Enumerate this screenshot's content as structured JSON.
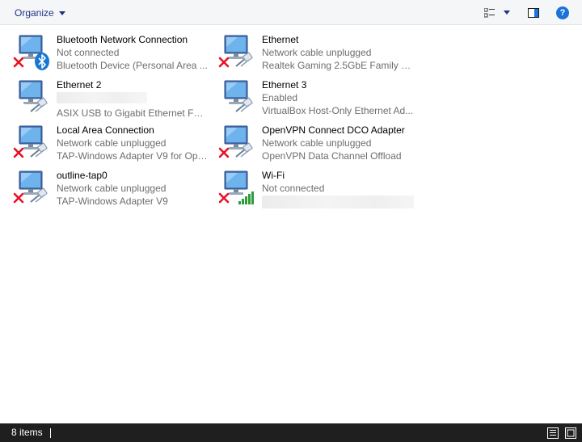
{
  "toolbar": {
    "organize_label": "Organize",
    "help_label": "?"
  },
  "adapters": [
    {
      "name": "Bluetooth Network Connection",
      "status": "Not connected",
      "device": "Bluetooth Device (Personal Area ...",
      "icon": "bluetooth-icon",
      "disconnected": true
    },
    {
      "name": "Ethernet",
      "status": "Network cable unplugged",
      "device": "Realtek Gaming 2.5GbE Family Co...",
      "icon": "ethernet-cable-icon",
      "disconnected": true
    },
    {
      "name": "Ethernet 2",
      "status": "",
      "device": "ASIX USB to Gigabit Ethernet Fam...",
      "icon": "ethernet-cable-icon",
      "disconnected": false
    },
    {
      "name": "Ethernet 3",
      "status": "Enabled",
      "device": "VirtualBox Host-Only Ethernet Ad...",
      "icon": "ethernet-cable-icon",
      "disconnected": false
    },
    {
      "name": "Local Area Connection",
      "status": "Network cable unplugged",
      "device": "TAP-Windows Adapter V9 for Ope...",
      "icon": "ethernet-cable-icon",
      "disconnected": true
    },
    {
      "name": "OpenVPN Connect DCO Adapter",
      "status": "Network cable unplugged",
      "device": "OpenVPN Data Channel Offload",
      "icon": "ethernet-cable-icon",
      "disconnected": true
    },
    {
      "name": "outline-tap0",
      "status": "Network cable unplugged",
      "device": "TAP-Windows Adapter V9",
      "icon": "ethernet-cable-icon",
      "disconnected": true
    },
    {
      "name": "Wi-Fi",
      "status": "Not connected",
      "device": "",
      "icon": "wifi-signal-icon",
      "disconnected": true
    }
  ],
  "statusbar": {
    "item_count": "8 items"
  },
  "colors": {
    "toolbar_text": "#1e3287",
    "status_bar_bg": "#1f1f1f",
    "error_red": "#e81123",
    "wifi_green": "#2e9b3a"
  }
}
